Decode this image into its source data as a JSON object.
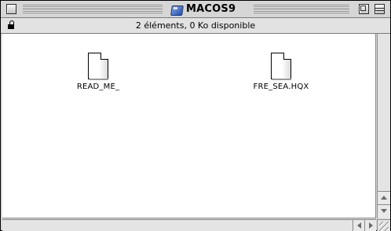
{
  "window": {
    "title": "MACOS9",
    "title_icon": "disk-icon"
  },
  "infobar": {
    "lock_icon": "lock-icon",
    "status_text": "2 éléments, 0  Ko disponible"
  },
  "files": [
    {
      "name": "READ_ME_",
      "icon": "document-icon"
    },
    {
      "name": "FRE_SEA.HQX",
      "icon": "document-icon"
    }
  ],
  "colors": {
    "titlebar": "#d6d6d6",
    "content_bg": "#ffffff",
    "frame": "#000000"
  }
}
